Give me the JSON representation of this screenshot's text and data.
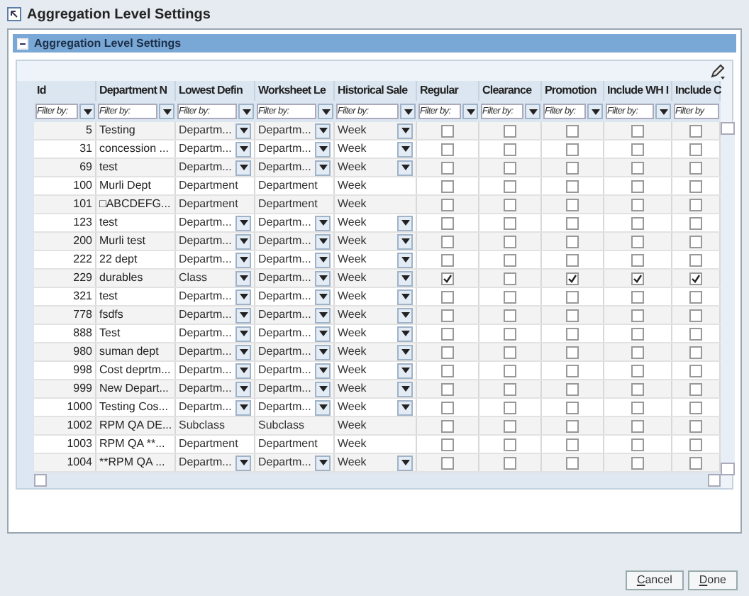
{
  "window": {
    "title": "Aggregation Level Settings"
  },
  "panel": {
    "title": "Aggregation Level Settings",
    "expanded": true
  },
  "table": {
    "columns": [
      {
        "label": "Id",
        "filter_placeholder": "Filter by:"
      },
      {
        "label": "Department N",
        "filter_placeholder": "Filter by:"
      },
      {
        "label": "Lowest Defin",
        "filter_placeholder": "Filter by:"
      },
      {
        "label": "Worksheet Le",
        "filter_placeholder": "Filter by:"
      },
      {
        "label": "Historical Sale",
        "filter_placeholder": "Filter by:"
      },
      {
        "label": "Regular",
        "filter_placeholder": "Filter by:"
      },
      {
        "label": "Clearance",
        "filter_placeholder": "Filter by:"
      },
      {
        "label": "Promotion",
        "filter_placeholder": "Filter by:"
      },
      {
        "label": "Include WH I",
        "filter_placeholder": "Filter by:"
      },
      {
        "label": "Include C",
        "filter_placeholder": "Filter by"
      }
    ],
    "rows": [
      {
        "id": "5",
        "department": "Testing",
        "lowest": "Departm...",
        "worksheet": "Departm...",
        "historical": "Week",
        "editable": true,
        "checks": [
          false,
          false,
          false,
          false,
          false
        ]
      },
      {
        "id": "31",
        "department": "concession ...",
        "lowest": "Departm...",
        "worksheet": "Departm...",
        "historical": "Week",
        "editable": true,
        "checks": [
          false,
          false,
          false,
          false,
          false
        ]
      },
      {
        "id": "69",
        "department": "test",
        "lowest": "Departm...",
        "worksheet": "Departm...",
        "historical": "Week",
        "editable": true,
        "checks": [
          false,
          false,
          false,
          false,
          false
        ]
      },
      {
        "id": "100",
        "department": "Murli Dept",
        "lowest": "Department",
        "worksheet": "Department",
        "historical": "Week",
        "editable": false,
        "checks": [
          false,
          false,
          false,
          false,
          false
        ]
      },
      {
        "id": "101",
        "department": "□ABCDEFG...",
        "lowest": "Department",
        "worksheet": "Department",
        "historical": "Week",
        "editable": false,
        "checks": [
          false,
          false,
          false,
          false,
          false
        ]
      },
      {
        "id": "123",
        "department": "test",
        "lowest": "Departm...",
        "worksheet": "Departm...",
        "historical": "Week",
        "editable": true,
        "checks": [
          false,
          false,
          false,
          false,
          false
        ]
      },
      {
        "id": "200",
        "department": "Murli test",
        "lowest": "Departm...",
        "worksheet": "Departm...",
        "historical": "Week",
        "editable": true,
        "checks": [
          false,
          false,
          false,
          false,
          false
        ]
      },
      {
        "id": "222",
        "department": "22 dept",
        "lowest": "Departm...",
        "worksheet": "Departm...",
        "historical": "Week",
        "editable": true,
        "checks": [
          false,
          false,
          false,
          false,
          false
        ]
      },
      {
        "id": "229",
        "department": "durables",
        "lowest": "Class",
        "worksheet": "Departm...",
        "historical": "Week",
        "editable": true,
        "checks": [
          true,
          false,
          true,
          true,
          true
        ]
      },
      {
        "id": "321",
        "department": "test",
        "lowest": "Departm...",
        "worksheet": "Departm...",
        "historical": "Week",
        "editable": true,
        "checks": [
          false,
          false,
          false,
          false,
          false
        ]
      },
      {
        "id": "778",
        "department": "fsdfs",
        "lowest": "Departm...",
        "worksheet": "Departm...",
        "historical": "Week",
        "editable": true,
        "checks": [
          false,
          false,
          false,
          false,
          false
        ]
      },
      {
        "id": "888",
        "department": "Test",
        "lowest": "Departm...",
        "worksheet": "Departm...",
        "historical": "Week",
        "editable": true,
        "checks": [
          false,
          false,
          false,
          false,
          false
        ]
      },
      {
        "id": "980",
        "department": "suman dept",
        "lowest": "Departm...",
        "worksheet": "Departm...",
        "historical": "Week",
        "editable": true,
        "checks": [
          false,
          false,
          false,
          false,
          false
        ]
      },
      {
        "id": "998",
        "department": "Cost deprtm...",
        "lowest": "Departm...",
        "worksheet": "Departm...",
        "historical": "Week",
        "editable": true,
        "checks": [
          false,
          false,
          false,
          false,
          false
        ]
      },
      {
        "id": "999",
        "department": "New Depart...",
        "lowest": "Departm...",
        "worksheet": "Departm...",
        "historical": "Week",
        "editable": true,
        "checks": [
          false,
          false,
          false,
          false,
          false
        ]
      },
      {
        "id": "1000",
        "department": "Testing Cos...",
        "lowest": "Departm...",
        "worksheet": "Departm...",
        "historical": "Week",
        "editable": true,
        "checks": [
          false,
          false,
          false,
          false,
          false
        ]
      },
      {
        "id": "1002",
        "department": "RPM QA DE...",
        "lowest": "Subclass",
        "worksheet": "Subclass",
        "historical": "Week",
        "editable": false,
        "checks": [
          false,
          false,
          false,
          false,
          false
        ]
      },
      {
        "id": "1003",
        "department": "RPM QA **...",
        "lowest": "Department",
        "worksheet": "Department",
        "historical": "Week",
        "editable": false,
        "checks": [
          false,
          false,
          false,
          false,
          false
        ]
      },
      {
        "id": "1004",
        "department": "**RPM QA ...",
        "lowest": "Departm...",
        "worksheet": "Departm...",
        "historical": "Week",
        "editable": true,
        "checks": [
          false,
          false,
          false,
          false,
          false
        ]
      }
    ]
  },
  "buttons": [
    {
      "label": "Cancel"
    },
    {
      "label": "Done"
    }
  ]
}
